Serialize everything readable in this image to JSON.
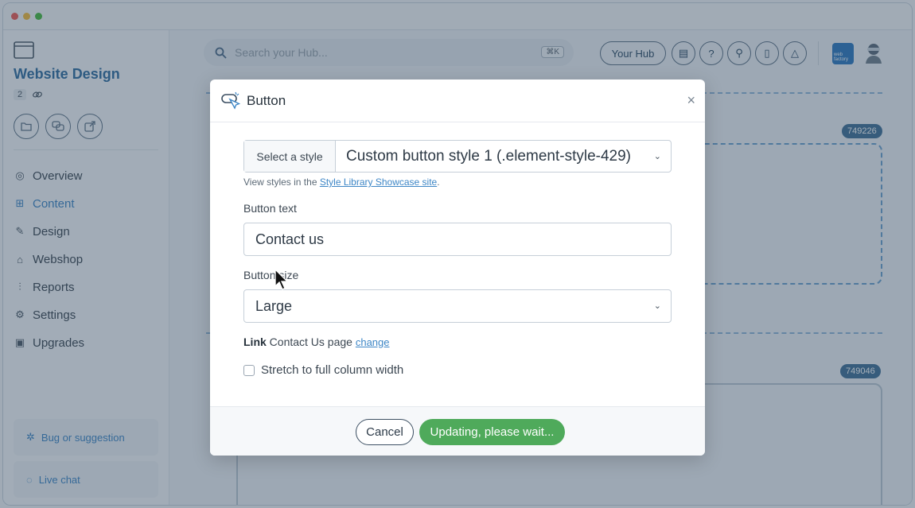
{
  "sidebar": {
    "site_title": "Website Design",
    "counter": "2",
    "nav": [
      {
        "label": "Overview"
      },
      {
        "label": "Content"
      },
      {
        "label": "Design"
      },
      {
        "label": "Webshop"
      },
      {
        "label": "Reports"
      },
      {
        "label": "Settings"
      },
      {
        "label": "Upgrades"
      }
    ],
    "bug_label": "Bug or suggestion",
    "chat_label": "Live chat"
  },
  "topbar": {
    "search_placeholder": "Search your Hub...",
    "shortcut": "⌘K",
    "hub_label": "Your Hub",
    "logo_text": "web factory"
  },
  "canvas": {
    "badge_1": "749226",
    "badge_2": "749046"
  },
  "modal": {
    "title": "Button",
    "close": "×",
    "style_label": "Select a style",
    "style_value": "Custom button style 1 (.element-style-429)",
    "help_prefix": "View styles in the ",
    "help_link": "Style Library Showcase site",
    "help_suffix": ".",
    "button_text_label": "Button text",
    "button_text_value": "Contact us",
    "button_size_label": "Button size",
    "button_size_value": "Large",
    "link_bold": "Link",
    "link_target": " Contact Us page ",
    "link_change": "change",
    "stretch_label": "Stretch to full column width",
    "cancel_label": "Cancel",
    "update_label": "Updating, please wait..."
  },
  "colors": {
    "accent_blue": "#3d86c6",
    "success_green": "#4faa5b",
    "title_blue": "#2f6da1"
  }
}
